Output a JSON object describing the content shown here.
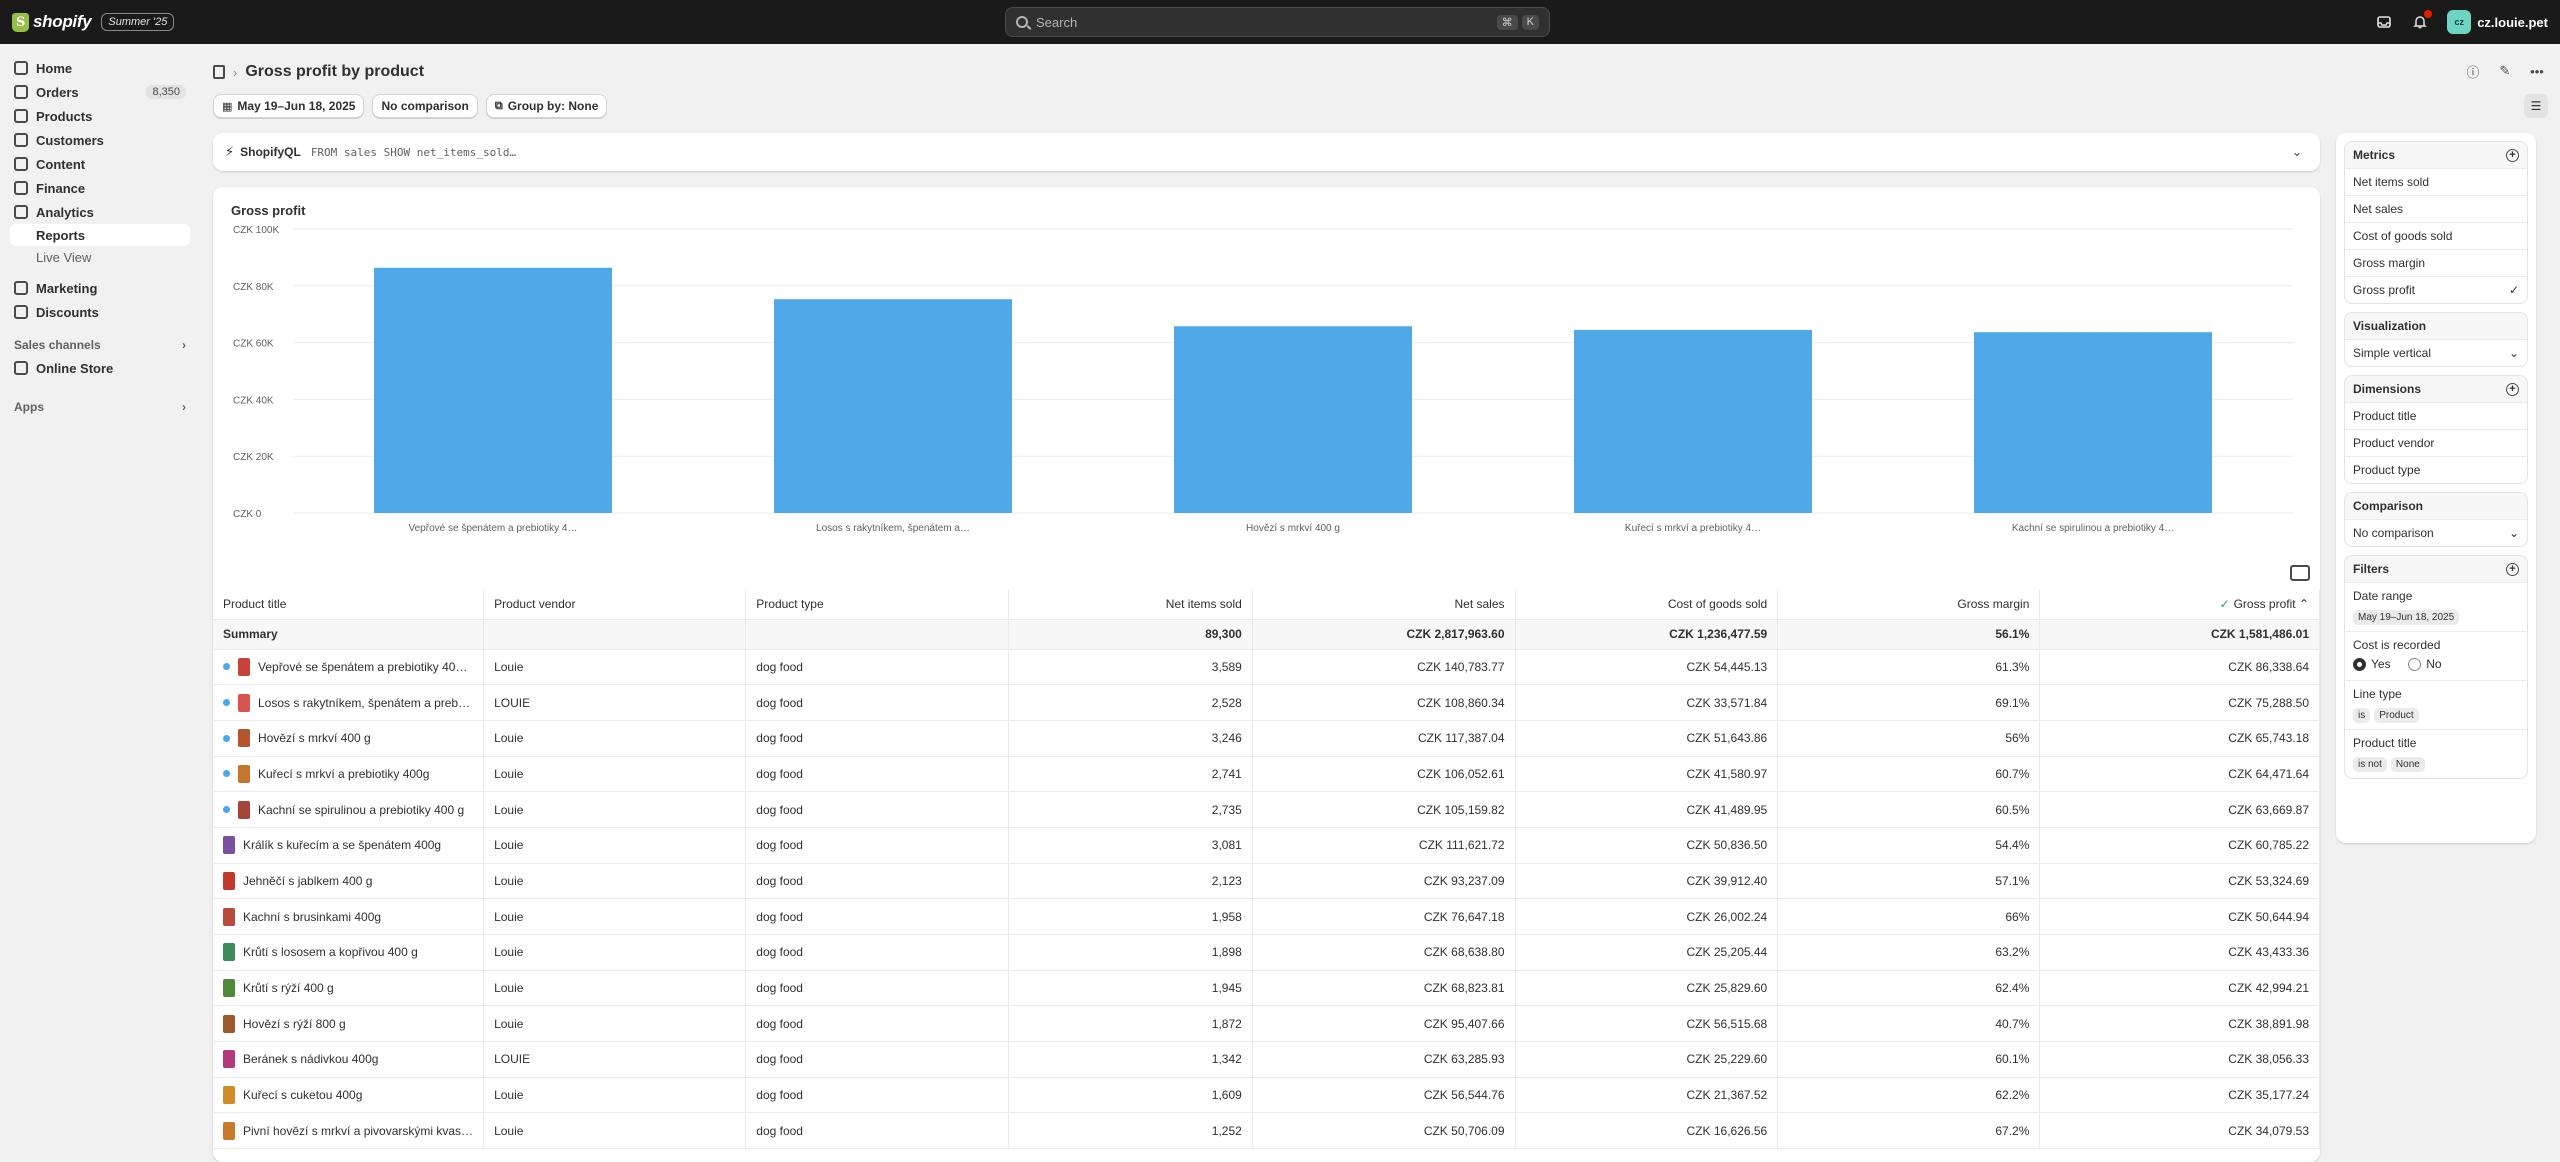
{
  "topbar": {
    "logo_text": "shopify",
    "edition_badge": "Summer '25",
    "search_placeholder": "Search",
    "shortcut_key1": "⌘",
    "shortcut_key2": "K",
    "store_name": "cz.louie.pet",
    "avatar_initials": "cz"
  },
  "sidebar": {
    "home": "Home",
    "orders": "Orders",
    "orders_count": "8,350",
    "products": "Products",
    "customers": "Customers",
    "content": "Content",
    "finance": "Finance",
    "analytics": "Analytics",
    "reports": "Reports",
    "live_view": "Live View",
    "marketing": "Marketing",
    "discounts": "Discounts",
    "sales_channels": "Sales channels",
    "online_store": "Online Store",
    "apps": "Apps"
  },
  "page": {
    "title": "Gross profit by product",
    "date_range": "May 19–Jun 18, 2025",
    "comparison": "No comparison",
    "group_by": "Group by: None",
    "ql_label": "ShopifyQL",
    "ql_code": "FROM sales SHOW net_items_sold…"
  },
  "chart_data": {
    "type": "bar",
    "title": "Gross profit",
    "categories": [
      "Vepřové se špenátem a prebiotiky 4…",
      "Losos s rakytníkem, špenátem a…",
      "Hovězí s mrkví 400 g",
      "Kuřecí s mrkví a prebiotiky 4…",
      "Kachní se spirulinou a prebiotiky 4…"
    ],
    "values": [
      86338.64,
      75288.5,
      65743.18,
      64471.64,
      63669.87
    ],
    "y_ticks": [
      "CZK 0",
      "CZK 20K",
      "CZK 40K",
      "CZK 60K",
      "CZK 80K",
      "CZK 100K"
    ],
    "ylim": [
      0,
      100000
    ],
    "grid": true,
    "color": "#4fa8e8"
  },
  "table": {
    "headers": [
      "Product title",
      "Product vendor",
      "Product type",
      "Net items sold",
      "Net sales",
      "Cost of goods sold",
      "Gross margin",
      "Gross profit"
    ],
    "summary": [
      "Summary",
      "",
      "",
      "89,300",
      "CZK 2,817,963.60",
      "CZK 1,236,477.59",
      "56.1%",
      "CZK 1,581,486.01"
    ],
    "rows": [
      {
        "dot": true,
        "thumb": "#c8413a",
        "cells": [
          "Vepřové se špenátem a prebiotiky 40…",
          "Louie",
          "dog food",
          "3,589",
          "CZK 140,783.77",
          "CZK 54,445.13",
          "61.3%",
          "CZK 86,338.64"
        ]
      },
      {
        "dot": true,
        "thumb": "#d9534f",
        "cells": [
          "Losos s rakytníkem, špenátem a preb…",
          "LOUIE",
          "dog food",
          "2,528",
          "CZK 108,860.34",
          "CZK 33,571.84",
          "69.1%",
          "CZK 75,288.50"
        ]
      },
      {
        "dot": true,
        "thumb": "#b5552b",
        "cells": [
          "Hovězí s mrkví 400 g",
          "Louie",
          "dog food",
          "3,246",
          "CZK 117,387.04",
          "CZK 51,643.86",
          "56%",
          "CZK 65,743.18"
        ]
      },
      {
        "dot": true,
        "thumb": "#c7752c",
        "cells": [
          "Kuřecí s mrkví a prebiotiky 400g",
          "Louie",
          "dog food",
          "2,741",
          "CZK 106,052.61",
          "CZK 41,580.97",
          "60.7%",
          "CZK 64,471.64"
        ]
      },
      {
        "dot": true,
        "thumb": "#a8433a",
        "cells": [
          "Kachní se spirulinou a prebiotiky 400 g",
          "Louie",
          "dog food",
          "2,735",
          "CZK 105,159.82",
          "CZK 41,489.95",
          "60.5%",
          "CZK 63,669.87"
        ]
      },
      {
        "dot": false,
        "thumb": "#7a4fa0",
        "cells": [
          "Králík s kuřecím a se špenátem 400g",
          "Louie",
          "dog food",
          "3,081",
          "CZK 111,621.72",
          "CZK 50,836.50",
          "54.4%",
          "CZK 60,785.22"
        ]
      },
      {
        "dot": false,
        "thumb": "#c0392b",
        "cells": [
          "Jehněčí s jablkem 400 g",
          "Louie",
          "dog food",
          "2,123",
          "CZK 93,237.09",
          "CZK 39,912.40",
          "57.1%",
          "CZK 53,324.69"
        ]
      },
      {
        "dot": false,
        "thumb": "#b84a3a",
        "cells": [
          "Kachní s brusinkami 400g",
          "Louie",
          "dog food",
          "1,958",
          "CZK 76,647.18",
          "CZK 26,002.24",
          "66%",
          "CZK 50,644.94"
        ]
      },
      {
        "dot": false,
        "thumb": "#3d8a5a",
        "cells": [
          "Krůtí s lososem a kopřivou 400 g",
          "Louie",
          "dog food",
          "1,898",
          "CZK 68,638.80",
          "CZK 25,205.44",
          "63.2%",
          "CZK 43,433.36"
        ]
      },
      {
        "dot": false,
        "thumb": "#4f8a3a",
        "cells": [
          "Krůtí s rýží 400 g",
          "Louie",
          "dog food",
          "1,945",
          "CZK 68,823.81",
          "CZK 25,829.60",
          "62.4%",
          "CZK 42,994.21"
        ]
      },
      {
        "dot": false,
        "thumb": "#9a5a2a",
        "cells": [
          "Hovězí s rýží 800 g",
          "Louie",
          "dog food",
          "1,872",
          "CZK 95,407.66",
          "CZK 56,515.68",
          "40.7%",
          "CZK 38,891.98"
        ]
      },
      {
        "dot": false,
        "thumb": "#b03a7a",
        "cells": [
          "Beránek s nádivkou 400g",
          "LOUIE",
          "dog food",
          "1,342",
          "CZK 63,285.93",
          "CZK 25,229.60",
          "60.1%",
          "CZK 38,056.33"
        ]
      },
      {
        "dot": false,
        "thumb": "#d08a2a",
        "cells": [
          "Kuřecí s cuketou 400g",
          "Louie",
          "dog food",
          "1,609",
          "CZK 56,544.76",
          "CZK 21,367.52",
          "62.2%",
          "CZK 35,177.24"
        ]
      },
      {
        "dot": false,
        "thumb": "#c8792a",
        "cells": [
          "Pivní hovězí s mrkví a pivovarskými kvas…",
          "Louie",
          "dog food",
          "1,252",
          "CZK 50,706.09",
          "CZK 16,626.56",
          "67.2%",
          "CZK 34,079.53"
        ]
      }
    ]
  },
  "panel": {
    "metrics_title": "Metrics",
    "metrics": [
      "Net items sold",
      "Net sales",
      "Cost of goods sold",
      "Gross margin",
      "Gross profit"
    ],
    "visualization_title": "Visualization",
    "visualization_value": "Simple vertical",
    "dimensions_title": "Dimensions",
    "dimensions": [
      "Product title",
      "Product vendor",
      "Product type"
    ],
    "comparison_title": "Comparison",
    "comparison_value": "No comparison",
    "filters_title": "Filters",
    "date_range_label": "Date range",
    "date_range_value": "May 19–Jun 18, 2025",
    "cost_label": "Cost is recorded",
    "yes": "Yes",
    "no": "No",
    "line_type_label": "Line type",
    "line_type_op": "is",
    "line_type_value": "Product",
    "product_title_label": "Product title",
    "product_title_op": "is not",
    "product_title_value": "None"
  }
}
